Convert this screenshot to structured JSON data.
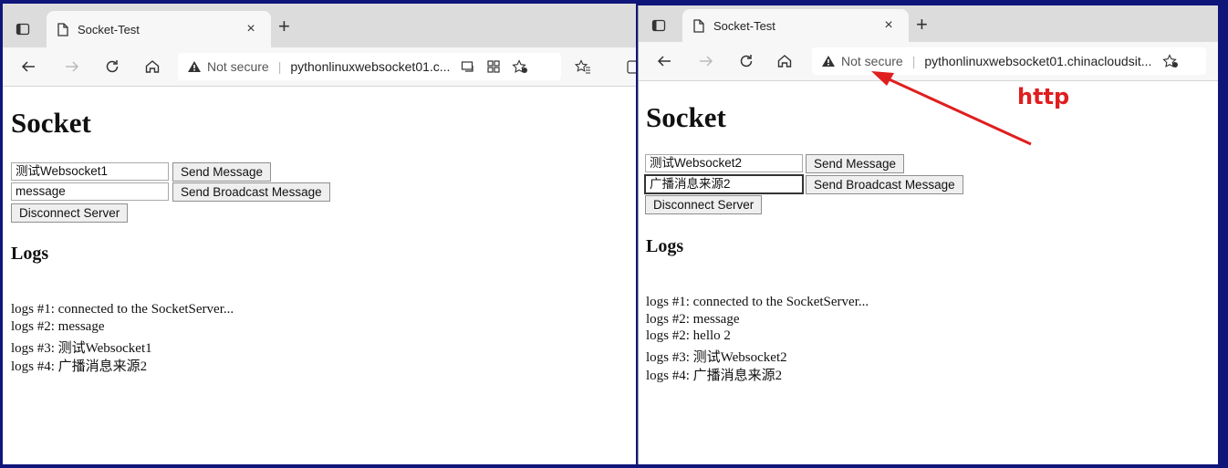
{
  "left_window": {
    "tab": {
      "title": "Socket-Test",
      "close_glyph": "×"
    },
    "new_tab_glyph": "+",
    "address": {
      "security_label": "Not secure",
      "url": "pythonlinuxwebsocket01.c..."
    },
    "page": {
      "heading": "Socket",
      "message_input": "测试Websocket1",
      "broadcast_input": "message",
      "send_button": "Send Message",
      "broadcast_button": "Send Broadcast Message",
      "disconnect_button": "Disconnect Server",
      "logs_heading": "Logs",
      "logs": [
        "logs #1: connected to the SocketServer...",
        "logs #2: message",
        "logs #3: 测试Websocket1",
        "logs #4: 广播消息来源2"
      ]
    }
  },
  "right_window": {
    "tab": {
      "title": "Socket-Test",
      "close_glyph": "×"
    },
    "new_tab_glyph": "+",
    "address": {
      "security_label": "Not secure",
      "url": "pythonlinuxwebsocket01.chinacloudsit..."
    },
    "page": {
      "heading": "Socket",
      "message_input": "测试Websocket2",
      "broadcast_input": "广播消息来源2",
      "send_button": "Send Message",
      "broadcast_button": "Send Broadcast Message",
      "disconnect_button": "Disconnect Server",
      "logs_heading": "Logs",
      "logs": [
        "logs #1: connected to the SocketServer...",
        "logs #2: message",
        "logs #2: hello 2",
        "logs #3: 测试Websocket2",
        "logs #4: 广播消息来源2"
      ]
    }
  },
  "annotation": {
    "label": "http",
    "color": "#e01e1e"
  },
  "colors": {
    "background": "#10157a",
    "tabstrip": "#dcdcdc",
    "toolbar": "#f7f7f7"
  }
}
